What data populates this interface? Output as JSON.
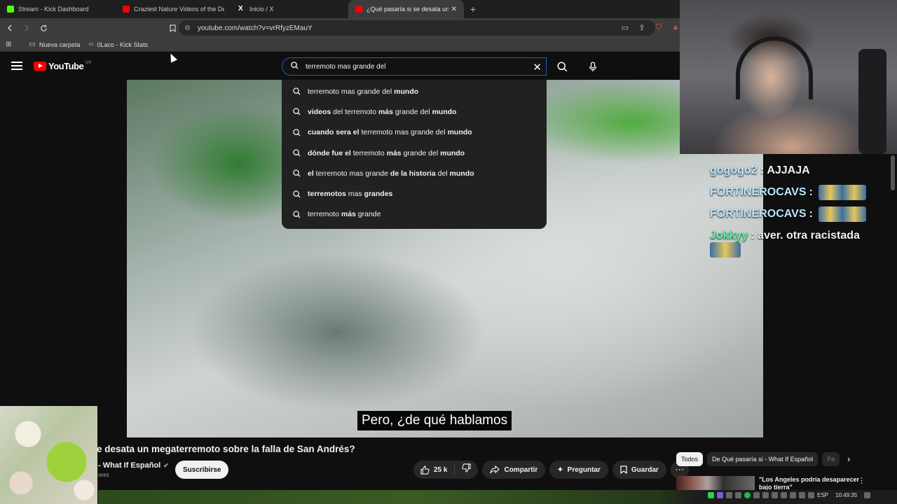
{
  "browser": {
    "tabs": [
      {
        "title": "Stream - Kick Dashboard",
        "favicon_color": "#53fc18"
      },
      {
        "title": "Craziest Nature Videos of the Decade",
        "favicon_color": "#ff0000"
      },
      {
        "title": "Inicio / X",
        "favicon_color": "#ffffff"
      },
      {
        "title": "¿Qué pasaría si se desata un megaterremoto",
        "favicon_color": "#ff0000"
      }
    ],
    "new_tab": "+",
    "url": "youtube.com/watch?v=vrRfyzEMauY",
    "bookmarks": [
      "Nueva carpeta",
      "0Laco - Kick Stats"
    ]
  },
  "youtube": {
    "logo_text": "YouTube",
    "country_code": "UY",
    "search_value": "terremoto mas grande del",
    "suggestions": [
      {
        "parts": [
          {
            "t": "terremoto mas grande del ",
            "b": false
          },
          {
            "t": "mundo",
            "b": true
          }
        ]
      },
      {
        "parts": [
          {
            "t": "videos",
            "b": true
          },
          {
            "t": " del terremoto ",
            "b": false
          },
          {
            "t": "más",
            "b": true
          },
          {
            "t": " grande del ",
            "b": false
          },
          {
            "t": "mundo",
            "b": true
          }
        ]
      },
      {
        "parts": [
          {
            "t": "cuando sera el",
            "b": true
          },
          {
            "t": " terremoto mas grande del ",
            "b": false
          },
          {
            "t": "mundo",
            "b": true
          }
        ]
      },
      {
        "parts": [
          {
            "t": "dónde fue el",
            "b": true
          },
          {
            "t": " terremoto ",
            "b": false
          },
          {
            "t": "más",
            "b": true
          },
          {
            "t": " grande del ",
            "b": false
          },
          {
            "t": "mundo",
            "b": true
          }
        ]
      },
      {
        "parts": [
          {
            "t": "el",
            "b": true
          },
          {
            "t": " terremoto mas grande ",
            "b": false
          },
          {
            "t": "de la historia",
            "b": true
          },
          {
            "t": " del ",
            "b": false
          },
          {
            "t": "mundo",
            "b": true
          }
        ]
      },
      {
        "parts": [
          {
            "t": "terremotos",
            "b": true
          },
          {
            "t": " mas ",
            "b": false
          },
          {
            "t": "grandes",
            "b": true
          }
        ]
      },
      {
        "parts": [
          {
            "t": "terremoto ",
            "b": false
          },
          {
            "t": "más",
            "b": true
          },
          {
            "t": " grande",
            "b": false
          }
        ]
      }
    ],
    "caption": "Pero, ¿de qué hablamos",
    "video_title": "e desata un megaterremoto sobre la falla de San Andrés?",
    "channel_name": "- What If Español",
    "subs_text": "ores",
    "subscribe_label": "Suscribirse",
    "like_count": "25 k",
    "share_label": "Compartir",
    "ask_label": "Preguntar",
    "save_label": "Guardar",
    "chips": [
      "Todos",
      "De Qué pasaría si - What If Español",
      "Pa"
    ],
    "related_title": "\"Los Angeles podría desaparecer bajo tierra\""
  },
  "chat": {
    "messages": [
      {
        "user": "gogogo2",
        "user_color": "#b9e6ff",
        "text": "AJJAJA",
        "emote": false
      },
      {
        "user": "FORTINEROCAVS",
        "user_color": "#b9e6ff",
        "text": "",
        "emote": true
      },
      {
        "user": "FORTINEROCAVS",
        "user_color": "#b9e6ff",
        "text": "",
        "emote": true
      },
      {
        "user": "Jokkyy",
        "user_color": "#5ef0a8",
        "text": "aver. otra racistada",
        "emote": false
      }
    ]
  },
  "system": {
    "lang": "ESP",
    "time": "10:49:35"
  }
}
